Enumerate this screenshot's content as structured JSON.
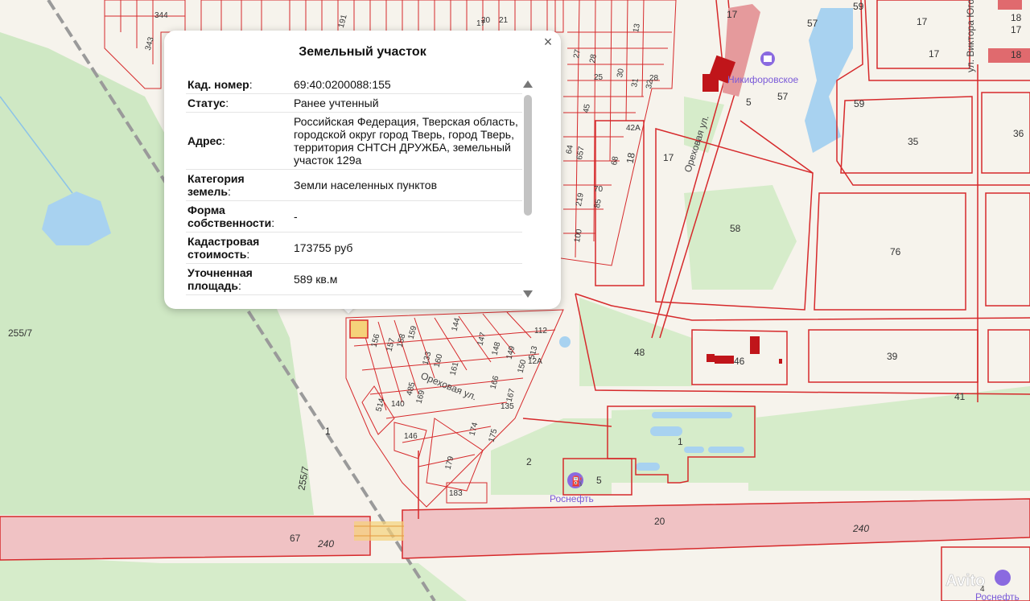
{
  "popup": {
    "title": "Земельный участок",
    "rows": [
      {
        "label": "Кад. номер",
        "value": "69:40:0200088:155"
      },
      {
        "label": "Статус",
        "value": "Ранее учтенный"
      },
      {
        "label": "Адрес",
        "value": "Российская Федерация, Тверская область, городской округ город Тверь, город Тверь, территория СНТСН ДРУЖБА, земельный участок 129а"
      },
      {
        "label": "Категория земель",
        "value": "Земли населенных пунктов"
      },
      {
        "label": "Форма собственности",
        "value": "-"
      },
      {
        "label": "Кадастровая стоимость",
        "value": "173755 руб"
      },
      {
        "label": "Уточненная площадь",
        "value": "589 кв.м"
      }
    ],
    "close_glyph": "×"
  },
  "map": {
    "streets": [
      "Ореховая ул.",
      "Ореховая ул.",
      "ул. Виктора Юго"
    ],
    "pois": [
      "Никифоровское",
      "Роснефть",
      "Роснефть"
    ],
    "road_numbers": [
      "240",
      "240"
    ],
    "parcels": [
      "255/7",
      "255/7",
      "67",
      "20",
      "1",
      "2",
      "5",
      "1",
      "48",
      "46",
      "39",
      "41",
      "76",
      "58",
      "17",
      "18",
      "35",
      "36",
      "59",
      "57",
      "57",
      "5",
      "17",
      "17",
      "17",
      "17",
      "18",
      "18",
      "59",
      "42А",
      "45",
      "657",
      "64",
      "68",
      "219",
      "85",
      "100",
      "70",
      "156",
      "157",
      "158",
      "159",
      "144",
      "147",
      "148",
      "149",
      "133",
      "160",
      "161",
      "150",
      "513",
      "166",
      "167",
      "485",
      "169",
      "514",
      "140",
      "146",
      "174",
      "175",
      "179",
      "183",
      "135",
      "112",
      "12А",
      "25",
      "27",
      "28",
      "30",
      "31",
      "32",
      "28",
      "13",
      "344",
      "343",
      "191",
      "20",
      "21",
      "17",
      "4"
    ]
  },
  "watermark": "Avito",
  "colors": {
    "parcel_line": "#d6292b",
    "road_fill": "#f0c2c4",
    "forest": "#cfe8c4",
    "water": "#a8d2f0",
    "building": "#c0151a"
  }
}
